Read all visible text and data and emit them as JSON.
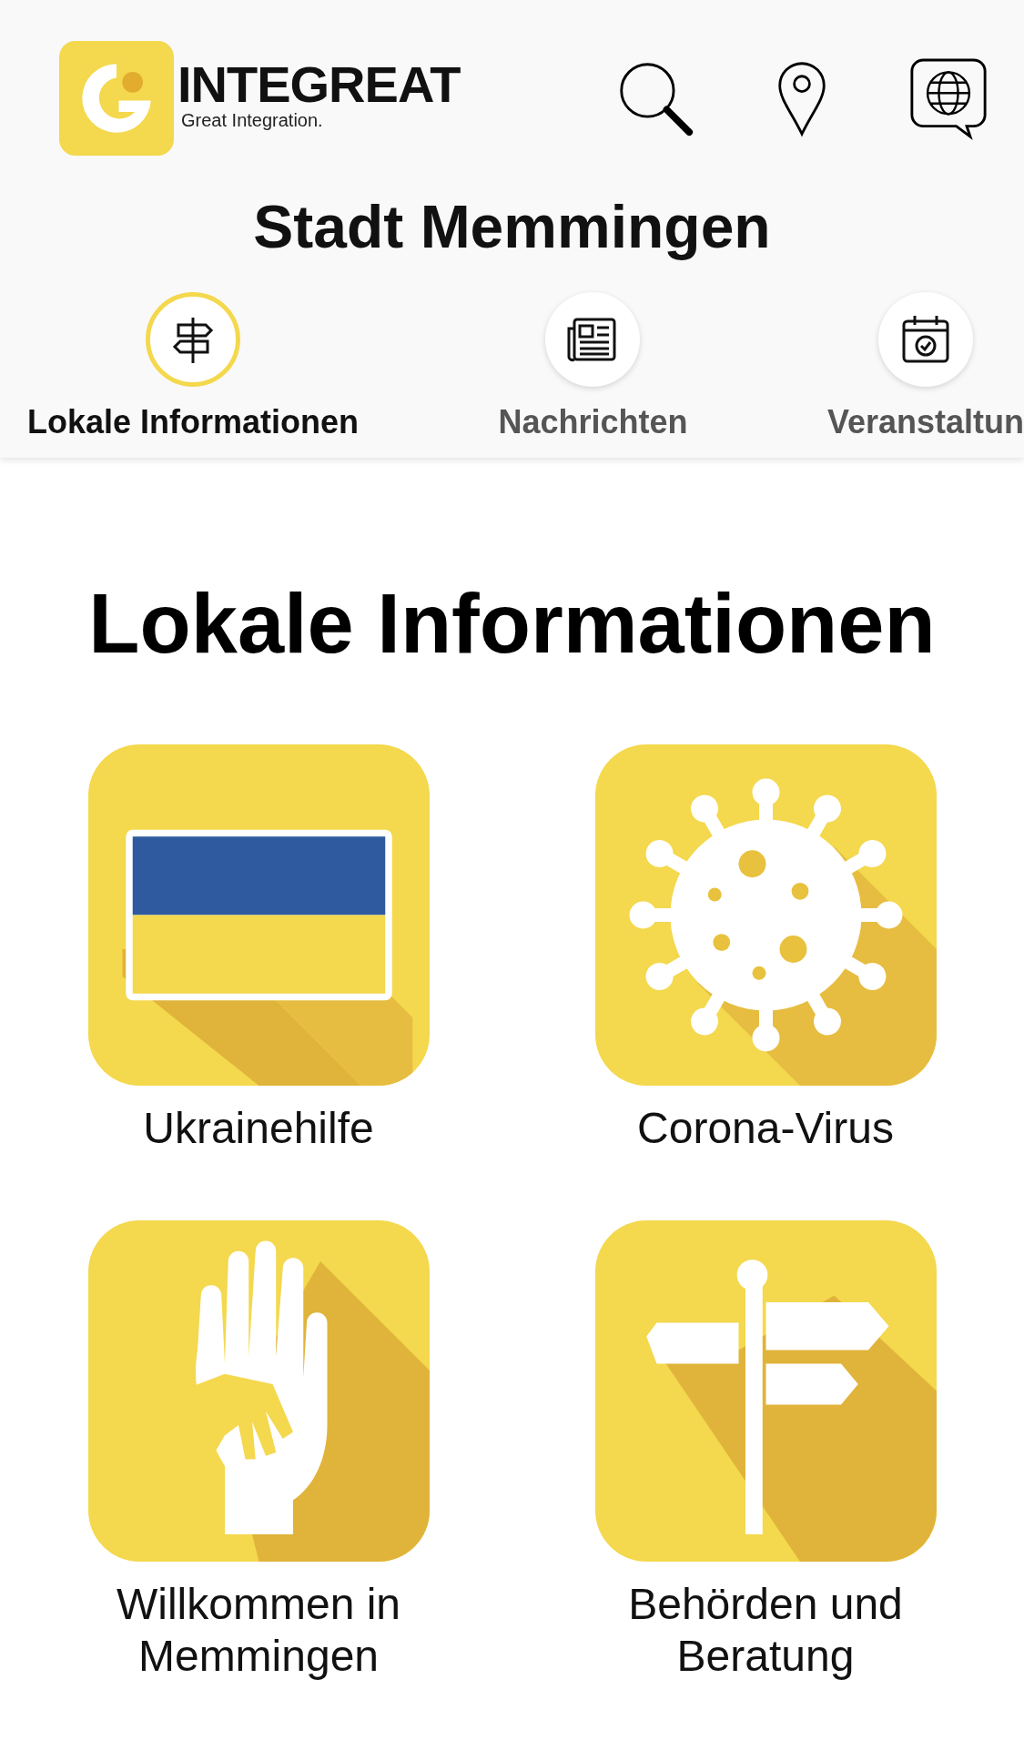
{
  "header": {
    "logo": {
      "name": "INTEGREAT",
      "tagline": "Great Integration."
    },
    "actions": [
      {
        "kind": "search"
      },
      {
        "kind": "location"
      },
      {
        "kind": "language"
      }
    ]
  },
  "city": "Stadt Memmingen",
  "tabs": [
    {
      "label": "Lokale Informationen",
      "kind": "signpost",
      "selected": true
    },
    {
      "label": "Nachrichten",
      "kind": "news",
      "selected": false
    },
    {
      "label": "Veranstaltun",
      "kind": "calendar",
      "selected": false
    }
  ],
  "page_title": "Lokale Informationen",
  "categories": [
    {
      "label": "Ukrainehilfe",
      "kind": "flag"
    },
    {
      "label": "Corona-Virus",
      "kind": "virus"
    },
    {
      "label": "Willkommen in Memmingen",
      "kind": "hand"
    },
    {
      "label": "Behörden und Beratung",
      "kind": "signpost"
    }
  ]
}
